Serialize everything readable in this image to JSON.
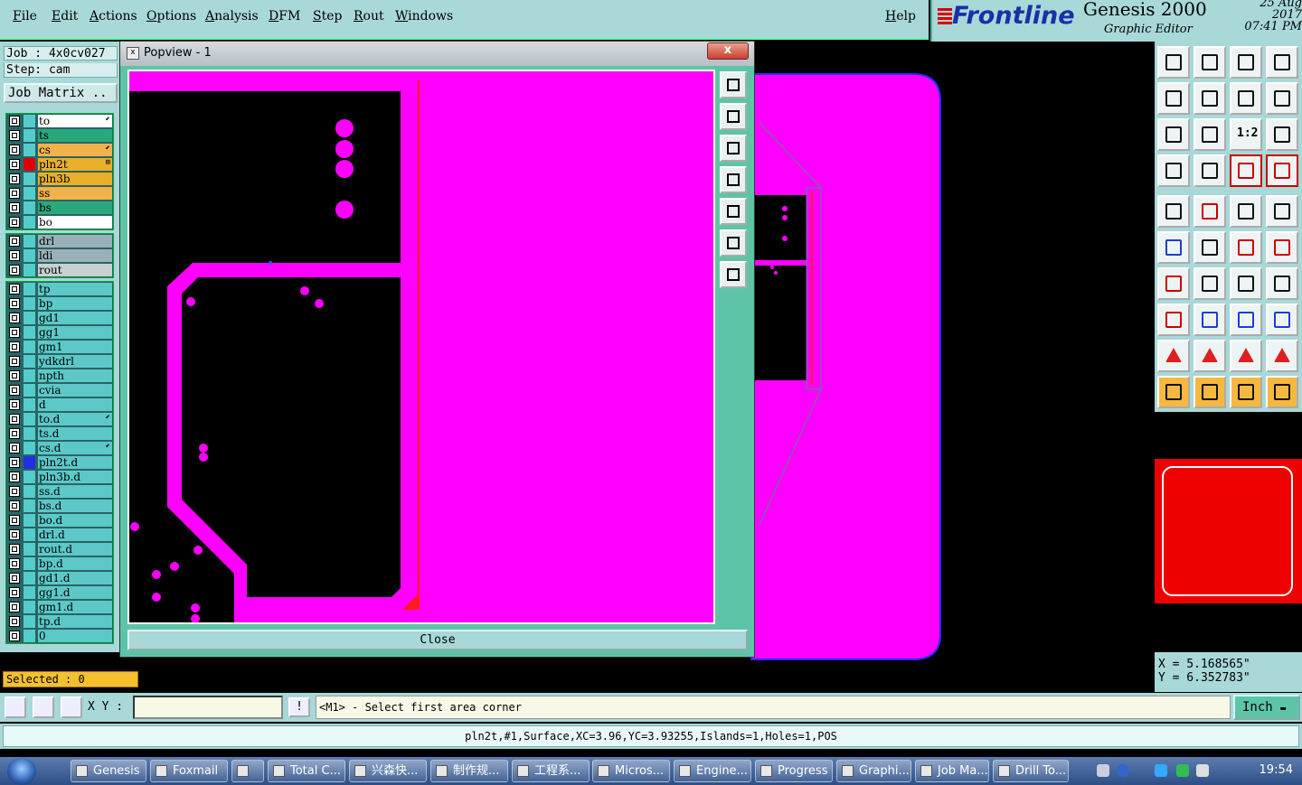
{
  "menu": {
    "items": [
      "File",
      "Edit",
      "Actions",
      "Options",
      "Analysis",
      "DFM",
      "Step",
      "Rout",
      "Windows"
    ],
    "help": "Help"
  },
  "brand": {
    "logo": "Frontline",
    "title": "Genesis 2000",
    "subtitle": "Graphic Editor",
    "date": "25 Aug 2017",
    "time": "07:41 PM"
  },
  "job": {
    "job_line": "Job : 4x0cv027",
    "step_line": "Step: cam",
    "matrix_label": "Job Matrix .."
  },
  "layers": {
    "group1": [
      {
        "name": "to",
        "color": "#ffffff",
        "tag": "⬋"
      },
      {
        "name": "ts",
        "color": "#2aa87c",
        "tag": ""
      },
      {
        "name": "cs",
        "color": "#f2b24a",
        "tag": "⬋"
      },
      {
        "name": "pln2t",
        "color": "#e8b02a",
        "tag": "⊞",
        "active": "#e00000"
      },
      {
        "name": "pln3b",
        "color": "#e8b02a",
        "tag": ""
      },
      {
        "name": "ss",
        "color": "#f2b24a",
        "tag": ""
      },
      {
        "name": "bs",
        "color": "#2aa87c",
        "tag": ""
      },
      {
        "name": "bo",
        "color": "#ffffff",
        "tag": ""
      }
    ],
    "group2": [
      {
        "name": "drl",
        "color": "#9ab0b8",
        "tag": ""
      },
      {
        "name": "ldi",
        "color": "#9ab0b8",
        "tag": ""
      },
      {
        "name": "rout",
        "color": "#c8d0d0",
        "tag": ""
      }
    ],
    "group3": [
      {
        "name": "tp",
        "color": "#5cc8c8",
        "tag": ""
      },
      {
        "name": "bp",
        "color": "#5cc8c8",
        "tag": ""
      },
      {
        "name": "gd1",
        "color": "#5cc8c8",
        "tag": ""
      },
      {
        "name": "gg1",
        "color": "#5cc8c8",
        "tag": ""
      },
      {
        "name": "gm1",
        "color": "#5cc8c8",
        "tag": ""
      },
      {
        "name": "ydkdrl",
        "color": "#5cc8c8",
        "tag": ""
      },
      {
        "name": "npth",
        "color": "#5cc8c8",
        "tag": ""
      },
      {
        "name": "cvia",
        "color": "#5cc8c8",
        "tag": ""
      },
      {
        "name": "d",
        "color": "#5cc8c8",
        "tag": ""
      },
      {
        "name": "to.d",
        "color": "#5cc8c8",
        "tag": "⬋"
      },
      {
        "name": "ts.d",
        "color": "#5cc8c8",
        "tag": ""
      },
      {
        "name": "cs.d",
        "color": "#5cc8c8",
        "tag": "⬋"
      },
      {
        "name": "pln2t.d",
        "color": "#5cc8c8",
        "tag": "",
        "active": "#2030e0"
      },
      {
        "name": "pln3b.d",
        "color": "#5cc8c8",
        "tag": ""
      },
      {
        "name": "ss.d",
        "color": "#5cc8c8",
        "tag": ""
      },
      {
        "name": "bs.d",
        "color": "#5cc8c8",
        "tag": ""
      },
      {
        "name": "bo.d",
        "color": "#5cc8c8",
        "tag": ""
      },
      {
        "name": "drl.d",
        "color": "#5cc8c8",
        "tag": ""
      },
      {
        "name": "rout.d",
        "color": "#5cc8c8",
        "tag": ""
      },
      {
        "name": "bp.d",
        "color": "#5cc8c8",
        "tag": ""
      },
      {
        "name": "gd1.d",
        "color": "#5cc8c8",
        "tag": ""
      },
      {
        "name": "gg1.d",
        "color": "#5cc8c8",
        "tag": ""
      },
      {
        "name": "gm1.d",
        "color": "#5cc8c8",
        "tag": ""
      },
      {
        "name": "tp.d",
        "color": "#5cc8c8",
        "tag": ""
      },
      {
        "name": "0",
        "color": "#5cc8c8",
        "tag": ""
      }
    ]
  },
  "selected": "Selected : 0",
  "popview": {
    "title": "Popview - 1",
    "close_x": "x",
    "close_label": "Close",
    "tools": [
      "zoom-home-icon",
      "pan-up-icon",
      "pan-down-icon",
      "pan-left-icon",
      "pan-right-icon",
      "zoom-fit-icon",
      "zoom-out-icon"
    ]
  },
  "tools": {
    "rows": [
      [
        "pan-up-icon",
        "pan-down-icon",
        "home-icon",
        "split-icon"
      ],
      [
        "pan-left-icon",
        "pan-right-icon",
        "undo-icon",
        "redraw-icon"
      ],
      [
        "zoom-fit-icon",
        "zoom-out-icon",
        "ratio-icon",
        "help-icon"
      ],
      [
        "measure-tools-icon",
        "grid-icon",
        "snap-icon",
        "snap-alt-icon"
      ],
      [
        "pad-icon",
        "line-red-icon",
        "ruler-icon",
        "dot-icon"
      ],
      [
        "connect-icon",
        "cross-icon",
        "line-end-icon",
        "line-start-icon"
      ],
      [
        "angle-icon",
        "slash-icon",
        "arc-icon",
        "text-f-icon"
      ],
      [
        "move-icon",
        "dash-icon",
        "dimension-icon",
        "shapes-icon"
      ],
      [
        "triangle-a-icon",
        "triangle-b-icon",
        "triangle-c-icon",
        "triangle-d-icon"
      ],
      [
        "select-arrow-icon",
        "select-box-icon",
        "select-rotate-icon",
        "select-path-icon"
      ]
    ],
    "ratio_label": "1:2"
  },
  "coords": {
    "x": "X = 5.168565\"",
    "y": "Y = 6.352783\""
  },
  "cmd": {
    "xy_label": "X Y :",
    "bang": "!",
    "prompt": "<M1> - Select first area corner",
    "units": "Inch"
  },
  "status": "pln2t,#1,Surface,XC=3.96,YC=3.93255,Islands=1,Holes=1,POS",
  "taskbar": {
    "tasks": [
      "Genesis",
      "Foxmail",
      "",
      "Total C...",
      "兴森快...",
      "制作规...",
      "工程系...",
      "Micros...",
      "Engine...",
      "Progress",
      "Graphi...",
      "Job Ma...",
      "Drill To..."
    ],
    "clock": "19:54"
  },
  "colors": {
    "copper": "#ff00ff",
    "panel": "#a8d8d8",
    "selection": "#ff0000"
  }
}
